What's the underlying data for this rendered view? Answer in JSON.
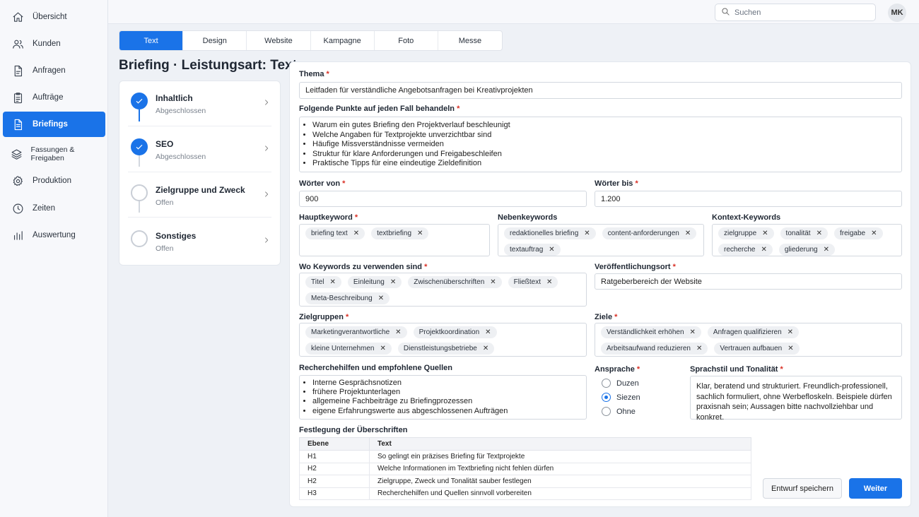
{
  "nav": {
    "items": [
      {
        "label": "Übersicht",
        "icon": "home-icon"
      },
      {
        "label": "Kunden",
        "icon": "users-icon"
      },
      {
        "label": "Anfragen",
        "icon": "document-icon"
      },
      {
        "label": "Aufträge",
        "icon": "clipboard-icon"
      },
      {
        "label": "Briefings",
        "icon": "file-text-icon"
      },
      {
        "label": "Fassungen & Freigaben",
        "icon": "layers-icon"
      },
      {
        "label": "Produktion",
        "icon": "gear-icon"
      },
      {
        "label": "Zeiten",
        "icon": "clock-icon"
      },
      {
        "label": "Auswertung",
        "icon": "bar-chart-icon"
      }
    ],
    "active": "Briefings"
  },
  "topbar": {
    "search_placeholder": "Suchen",
    "avatar_initials": "MK"
  },
  "tabs": [
    "Text",
    "Design",
    "Website",
    "Kampagne",
    "Foto",
    "Messe"
  ],
  "active_tab": "Text",
  "page_title": "Briefing · Leistungsart: Text",
  "steps": [
    {
      "name": "Inhaltlich",
      "state": "Abgeschlossen",
      "done": true
    },
    {
      "name": "SEO",
      "state": "Abgeschlossen",
      "done": true
    },
    {
      "name": "Zielgruppe und Zweck",
      "state": "Offen",
      "done": false
    },
    {
      "name": "Sonstiges",
      "state": "Offen",
      "done": false
    }
  ],
  "form": {
    "thema": {
      "label": "Thema",
      "value": "Leitfaden für verständliche Angebotsanfragen bei Kreativprojekten"
    },
    "punkte": {
      "label": "Folgende Punkte auf jeden Fall behandeln",
      "items": [
        "Warum ein gutes Briefing den Projektverlauf beschleunigt",
        "Welche Angaben für Textprojekte unverzichtbar sind",
        "Häufige Missverständnisse vermeiden",
        "Struktur für klare Anforderungen und Freigabeschleifen",
        "Praktische Tipps für eine eindeutige Zieldefinition"
      ]
    },
    "woerter_von": {
      "label": "Wörter von",
      "value": "900"
    },
    "woerter_bis": {
      "label": "Wörter bis",
      "value": "1.200"
    },
    "hauptkeyword": {
      "label": "Hauptkeyword",
      "chips": [
        "briefing text",
        "textbriefing"
      ]
    },
    "nebenkeywords": {
      "label": "Nebenkeywords",
      "chips": [
        "redaktionelles briefing",
        "content-anforderungen",
        "textauftrag"
      ]
    },
    "kontext_keywords": {
      "label": "Kontext-Keywords",
      "chips": [
        "zielgruppe",
        "tonalität",
        "freigabe",
        "recherche",
        "gliederung"
      ]
    },
    "keyword_orte": {
      "label": "Wo Keywords zu verwenden sind",
      "chips": [
        "Titel",
        "Einleitung",
        "Zwischenüberschriften",
        "Fließtext",
        "Meta-Beschreibung"
      ]
    },
    "veroeffentlichungsort": {
      "label": "Veröffentlichungsort",
      "value": "Ratgeberbereich der Website"
    },
    "zielgruppen": {
      "label": "Zielgruppen",
      "chips": [
        "Marketingverantwortliche",
        "Projektkoordination",
        "kleine Unternehmen",
        "Dienstleistungsbetriebe"
      ]
    },
    "ziele": {
      "label": "Ziele",
      "chips": [
        "Verständlichkeit erhöhen",
        "Anfragen qualifizieren",
        "Arbeitsaufwand reduzieren",
        "Vertrauen aufbauen"
      ]
    },
    "recherche": {
      "label": "Recherchehilfen und empfohlene Quellen",
      "items": [
        "Interne Gesprächsnotizen",
        "frühere Projektunterlagen",
        "allgemeine Fachbeiträge zu Briefingprozessen",
        "eigene Erfahrungswerte aus abgeschlossenen Aufträgen"
      ]
    },
    "ansprache": {
      "label": "Ansprache",
      "options": [
        "Duzen",
        "Siezen",
        "Ohne"
      ],
      "selected": "Siezen"
    },
    "sprachstil": {
      "label": "Sprachstil und Tonalität",
      "value": "Klar, beratend und strukturiert. Freundlich-professionell, sachlich formuliert, ohne Werbefloskeln. Beispiele dürfen praxisnah sein; Aussagen bitte nachvollziehbar und konkret."
    },
    "ueberschriften": {
      "label": "Festlegung der Überschriften",
      "columns": [
        "Ebene",
        "Text"
      ],
      "rows": [
        [
          "H1",
          "So gelingt ein präzises Briefing für Textprojekte"
        ],
        [
          "H2",
          "Welche Informationen im Textbriefing nicht fehlen dürfen"
        ],
        [
          "H2",
          "Zielgruppe, Zweck und Tonalität sauber festlegen"
        ],
        [
          "H3",
          "Recherchehilfen und Quellen sinnvoll vorbereiten"
        ]
      ]
    },
    "required_mark": "*"
  },
  "buttons": {
    "draft": "Entwurf speichern",
    "next": "Weiter"
  },
  "colors": {
    "accent": "#1a73e8",
    "required": "#d93025"
  }
}
